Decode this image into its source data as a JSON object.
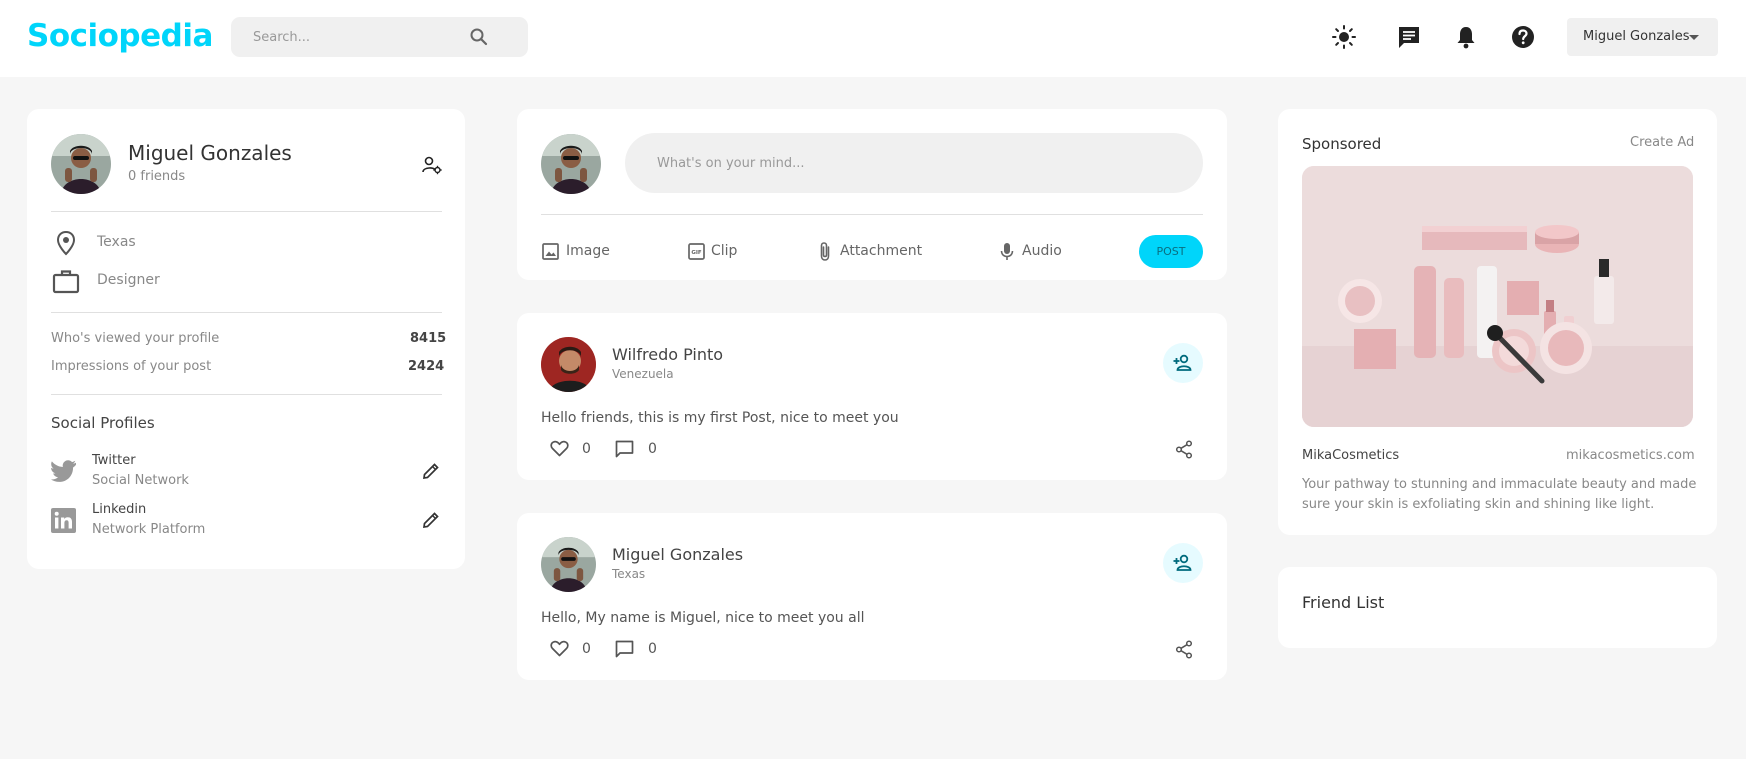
{
  "brand": {
    "logo": "Sociopedia",
    "accent": "#00d5fa"
  },
  "search": {
    "placeholder": "Search..."
  },
  "header": {
    "user_name": "Miguel Gonzales"
  },
  "profile": {
    "name": "Miguel Gonzales",
    "friends": "0 friends",
    "location": "Texas",
    "occupation": "Designer",
    "stats": [
      {
        "label": "Who's viewed your profile",
        "value": "8415"
      },
      {
        "label": "Impressions of your post",
        "value": "2424"
      }
    ],
    "social_title": "Social Profiles",
    "socials": [
      {
        "name": "Twitter",
        "sub": "Social Network"
      },
      {
        "name": "Linkedin",
        "sub": "Network Platform"
      }
    ]
  },
  "composer": {
    "placeholder": "What's on your mind...",
    "actions": {
      "image": "Image",
      "clip": "Clip",
      "attachment": "Attachment",
      "audio": "Audio"
    },
    "post_label": "POST"
  },
  "posts": [
    {
      "author": "Wilfredo Pinto",
      "location": "Venezuela",
      "text": "Hello friends, this is my first Post, nice to meet you",
      "likes": "0",
      "comments": "0"
    },
    {
      "author": "Miguel Gonzales",
      "location": "Texas",
      "text": "Hello, My name is Miguel, nice to meet you all",
      "likes": "0",
      "comments": "0"
    }
  ],
  "sponsored": {
    "title": "Sponsored",
    "create_ad": "Create Ad",
    "brand": "MikaCosmetics",
    "url": "mikacosmetics.com",
    "description_line1": "Your pathway to stunning and immaculate beauty and made",
    "description_line2": "sure your skin is exfoliating skin and shining like light."
  },
  "friend_list": {
    "title": "Friend List"
  }
}
